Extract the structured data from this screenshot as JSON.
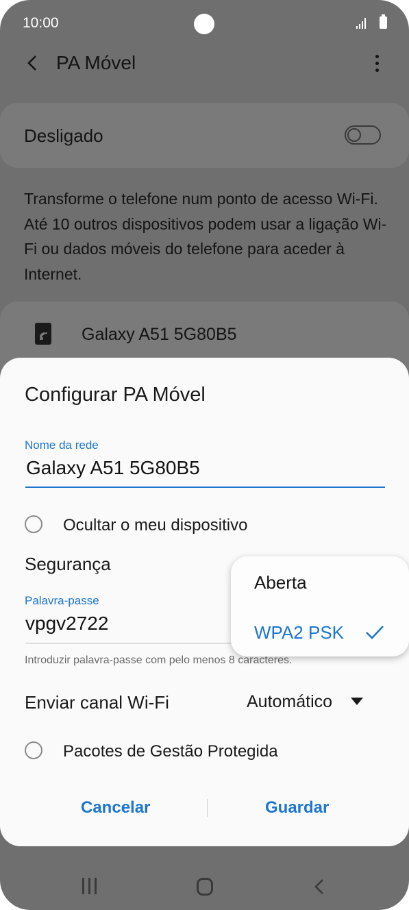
{
  "status_bar": {
    "time": "10:00"
  },
  "app_bar": {
    "title": "PA Móvel"
  },
  "hotspot": {
    "state_label": "Desligado",
    "description": "Transforme o telefone num ponto de acesso Wi-Fi. Até 10 outros dispositivos podem usar a ligação Wi-Fi ou dados móveis do telefone para aceder à Internet.",
    "network_name": "Galaxy A51 5G80B5"
  },
  "dialog": {
    "title": "Configurar PA Móvel",
    "network_name_label": "Nome da rede",
    "network_name_value": "Galaxy A51 5G80B5",
    "hide_device_label": "Ocultar o meu dispositivo",
    "security_label": "Segurança",
    "password_label": "Palavra-passe",
    "password_value": "vpgv2722",
    "password_hint": "Introduzir palavra-passe com pelo menos 8 caracteres.",
    "channel_label": "Enviar canal Wi-Fi",
    "channel_value": "Automático",
    "pmf_label": "Pacotes de Gestão Protegida",
    "cancel_label": "Cancelar",
    "save_label": "Guardar"
  },
  "security_menu": {
    "options": [
      {
        "label": "Aberta",
        "selected": false
      },
      {
        "label": "WPA2 PSK",
        "selected": true
      }
    ]
  },
  "colors": {
    "accent": "#1c76cf",
    "dialog_bg": "#fafafa",
    "dim_bg": "#6f6f6f"
  }
}
